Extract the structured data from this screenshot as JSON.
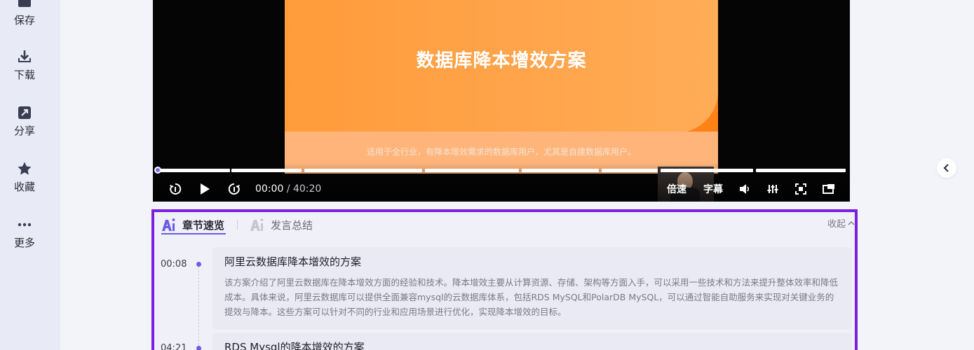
{
  "sidebar": {
    "items": [
      {
        "label": "保存",
        "icon": "save-icon"
      },
      {
        "label": "下载",
        "icon": "download-icon"
      },
      {
        "label": "分享",
        "icon": "share-icon"
      },
      {
        "label": "收藏",
        "icon": "star-icon"
      },
      {
        "label": "更多",
        "icon": "more-icon"
      }
    ]
  },
  "video": {
    "slide_title": "数据库降本增效方案",
    "slide_subtitle": "适用于全行业，有降本增效需求的数据库用户，尤其是自建数据库用户。",
    "current_time": "00:00",
    "total_time": "/ 40:20",
    "speed_label": "倍速",
    "subtitle_label": "字幕",
    "progress": 0
  },
  "panel": {
    "tabs": [
      {
        "label": "章节速览",
        "active": true
      },
      {
        "label": "发言总结",
        "active": false
      }
    ],
    "collapse_label": "收起",
    "chapters": [
      {
        "time": "00:08",
        "title": "阿里云数据库降本增效的方案",
        "body": "该方案介绍了阿里云数据库在降本增效方面的经验和技术。降本增效主要从计算资源、存储、架构等方面入手，可以采用一些技术和方法来提升整体效率和降低成本。具体来说，阿里云数据库可以提供全面兼容mysql的云数据库体系，包括RDS MySQL和PolarDB MySQL，可以通过智能自助服务来实现对关键业务的提效与降本。这些方案可以针对不同的行业和应用场景进行优化，实现降本增效的目标。"
      },
      {
        "time": "04:21",
        "title": "RDS Mysql的降本增效的方案"
      }
    ]
  },
  "colors": {
    "accent": "#6d5be8",
    "highlight_border": "#7b1fe0",
    "slide_orange": "#ff8a1f"
  }
}
